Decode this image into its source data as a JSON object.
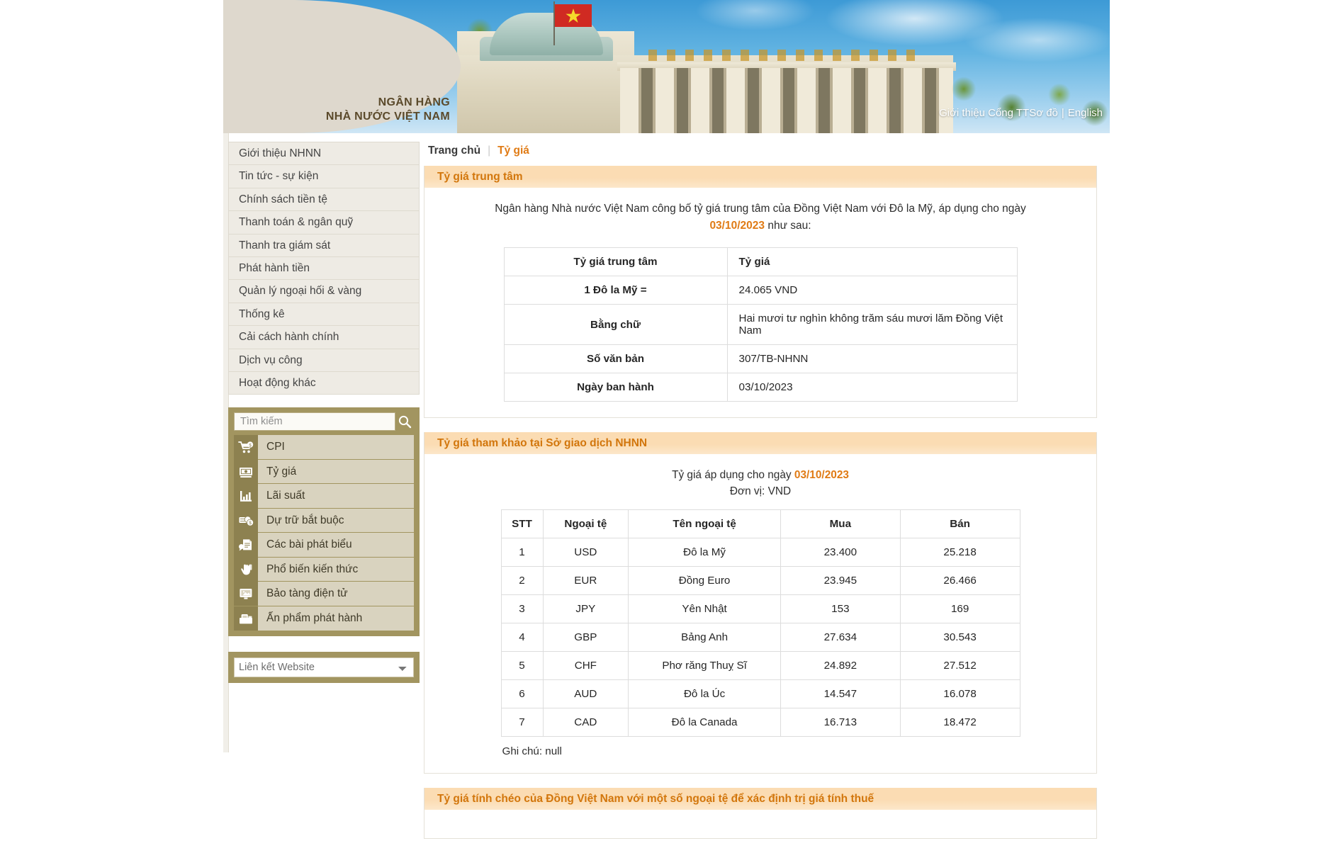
{
  "header": {
    "logo_line1": "NGÂN HÀNG",
    "logo_line2": "NHÀ NƯỚC VIỆT NAM",
    "top_links": [
      {
        "label": "Giới thiệu Cổng TTSơ đồ"
      },
      {
        "label": "English"
      }
    ],
    "top_links_separator": "|",
    "banner_colors": {
      "sky": "#63b4e2",
      "beige_panel": "#ded8cd",
      "logo_text": "#5b4a2b"
    }
  },
  "sidebar": {
    "menu": [
      {
        "label": "Giới thiệu NHNN"
      },
      {
        "label": "Tin tức - sự kiện"
      },
      {
        "label": "Chính sách tiền tệ"
      },
      {
        "label": "Thanh toán & ngân quỹ"
      },
      {
        "label": "Thanh tra giám sát"
      },
      {
        "label": "Phát hành tiền"
      },
      {
        "label": "Quản lý ngoại hối & vàng"
      },
      {
        "label": "Thống kê"
      },
      {
        "label": "Cải cách hành chính"
      },
      {
        "label": "Dịch vụ công"
      },
      {
        "label": "Hoạt động khác"
      }
    ],
    "search": {
      "placeholder": "Tìm kiếm",
      "value": "",
      "button_icon": "search-icon"
    },
    "quick_links": [
      {
        "label": "CPI",
        "icon": "shopping-cart-money-icon"
      },
      {
        "label": "Tỷ giá",
        "icon": "banknote-exchange-icon"
      },
      {
        "label": "Lãi suất",
        "icon": "bar-chart-icon"
      },
      {
        "label": "Dự trữ bắt buộc",
        "icon": "coins-stack-icon"
      },
      {
        "label": "Các bài phát biểu",
        "icon": "speech-document-icon"
      },
      {
        "label": "Phổ biến kiến thức",
        "icon": "hand-book-icon"
      },
      {
        "label": "Bảo tàng điện tử",
        "icon": "monitor-museum-icon"
      },
      {
        "label": "Ấn phẩm phát hành",
        "icon": "publication-icon"
      }
    ],
    "website_links_select": {
      "selected": "Liên kết Website",
      "options": [
        "Liên kết Website"
      ]
    },
    "panel_color": "#a29560"
  },
  "breadcrumb": {
    "home": "Trang chủ",
    "separator": "|",
    "current": "Tỷ giá"
  },
  "sections": {
    "central_rate": {
      "title": "Tỷ giá trung tâm",
      "intro_before": "Ngân hàng Nhà nước Việt Nam công bố tỷ giá trung tâm của Đồng Việt Nam với Đô la Mỹ, áp dụng cho ngày ",
      "intro_date": "03/10/2023",
      "intro_after": " như sau:",
      "table": {
        "header": {
          "key": "Tỷ giá trung tâm",
          "value": "Tỷ giá"
        },
        "rows": [
          {
            "key": "1 Đô la Mỹ =",
            "value": "24.065 VND"
          },
          {
            "key": "Bằng chữ",
            "value": "Hai mươi tư nghìn không trăm sáu mươi lăm Đồng Việt Nam"
          },
          {
            "key": "Số văn bản",
            "value": "307/TB-NHNN"
          },
          {
            "key": "Ngày ban hành",
            "value": "03/10/2023"
          }
        ]
      }
    },
    "reference_rate": {
      "title": "Tỷ giá tham khảo tại Sở giao dịch NHNN",
      "applied_label_before": "Tỷ giá áp dụng cho ngày ",
      "applied_date": "03/10/2023",
      "unit_label": "Đơn vị: VND",
      "columns": [
        "STT",
        "Ngoại tệ",
        "Tên ngoại tệ",
        "Mua",
        "Bán"
      ],
      "rows": [
        {
          "stt": "1",
          "code": "USD",
          "name": "Đô la Mỹ",
          "buy": "23.400",
          "sell": "25.218"
        },
        {
          "stt": "2",
          "code": "EUR",
          "name": "Đồng Euro",
          "buy": "23.945",
          "sell": "26.466"
        },
        {
          "stt": "3",
          "code": "JPY",
          "name": "Yên Nhật",
          "buy": "153",
          "sell": "169"
        },
        {
          "stt": "4",
          "code": "GBP",
          "name": "Bảng Anh",
          "buy": "27.634",
          "sell": "30.543"
        },
        {
          "stt": "5",
          "code": "CHF",
          "name": "Phơ răng Thuỵ Sĩ",
          "buy": "24.892",
          "sell": "27.512"
        },
        {
          "stt": "6",
          "code": "AUD",
          "name": "Đô la Úc",
          "buy": "14.547",
          "sell": "16.078"
        },
        {
          "stt": "7",
          "code": "CAD",
          "name": "Đô la Canada",
          "buy": "16.713",
          "sell": "18.472"
        }
      ],
      "note": "Ghi chú: null"
    },
    "cross_rate": {
      "title": "Tỷ giá tính chéo của Đồng Việt Nam với một số ngoại tệ để xác định trị giá tính thuế"
    }
  },
  "colors": {
    "accent_orange": "#e07b15",
    "panel_header_bg": "#fbdcb3",
    "gold": "#a29560",
    "menu_bg": "#eeebe4"
  }
}
